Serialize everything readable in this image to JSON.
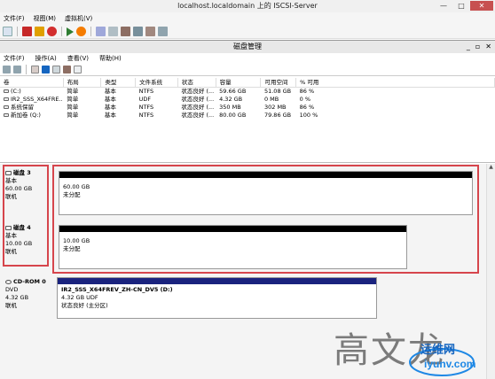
{
  "vm": {
    "title": "localhost.localdomain 上的 ISCSI-Server",
    "menu": [
      "文件(F)",
      "视图(M)",
      "虚拟机(V)"
    ]
  },
  "mmc": {
    "title": "磁盘管理",
    "menu": [
      "文件(F)",
      "操作(A)",
      "查看(V)",
      "帮助(H)"
    ]
  },
  "volumes": {
    "columns": [
      "卷",
      "布局",
      "类型",
      "文件系统",
      "状态",
      "容量",
      "可用空间",
      "% 可用"
    ],
    "rows": [
      [
        "(C:)",
        "简单",
        "基本",
        "NTFS",
        "状态良好 (...",
        "59.66 GB",
        "51.08 GB",
        "86 %"
      ],
      [
        "IR2_SSS_X64FRE...",
        "简单",
        "基本",
        "UDF",
        "状态良好 (...",
        "4.32 GB",
        "0 MB",
        "0 %"
      ],
      [
        "系统保留",
        "简单",
        "基本",
        "NTFS",
        "状态良好 (...",
        "350 MB",
        "302 MB",
        "86 %"
      ],
      [
        "新加卷 (Q:)",
        "简单",
        "基本",
        "NTFS",
        "状态良好 (...",
        "80.00 GB",
        "79.86 GB",
        "100 %"
      ]
    ]
  },
  "disks": [
    {
      "name": "磁盘 3",
      "type": "基本",
      "size": "60.00 GB",
      "status": "联机",
      "part_size": "60.00 GB",
      "part_status": "未分配"
    },
    {
      "name": "磁盘 4",
      "type": "基本",
      "size": "10.00 GB",
      "status": "联机",
      "part_size": "10.00 GB",
      "part_status": "未分配"
    },
    {
      "name": "CD-ROM 0",
      "type": "DVD",
      "size": "4.32 GB",
      "status": "联机",
      "part_name": "IR2_SSS_X64FREV_ZH-CN_DV5 (D:)",
      "part_size": "4.32 GB UDF",
      "part_status": "状态良好 (主分区)"
    }
  ],
  "watermark": {
    "chars": "高文龙",
    "site": "运维网",
    "url": "iyunv.com"
  },
  "colors": {
    "highlight_red": "#d6454c",
    "unallocated_bar": "#000000",
    "primary_partition_bar": "#1a237e"
  }
}
